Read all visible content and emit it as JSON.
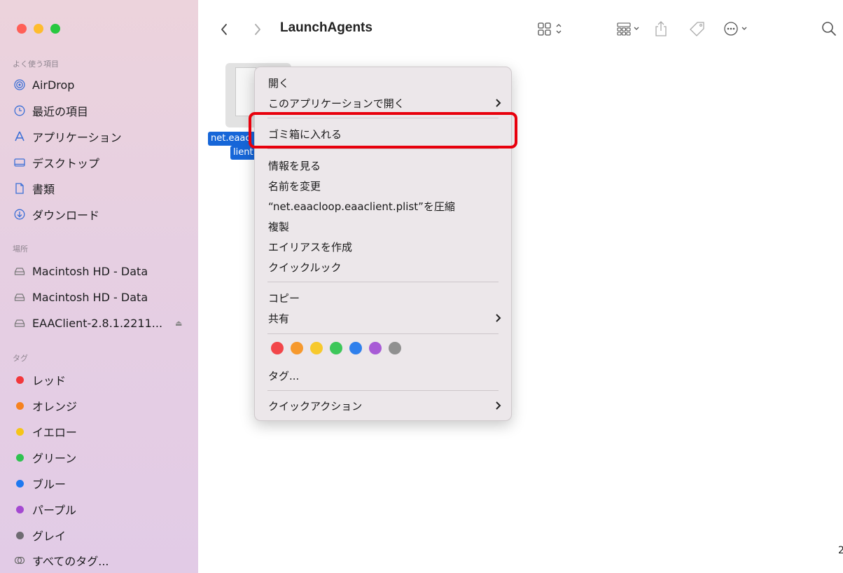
{
  "window": {
    "folder_title": "LaunchAgents"
  },
  "sidebar": {
    "favorites_title": "よく使う項目",
    "favorites": [
      {
        "label": "AirDrop",
        "icon": "airdrop-icon"
      },
      {
        "label": "最近の項目",
        "icon": "clock-icon"
      },
      {
        "label": "アプリケーション",
        "icon": "applications-icon"
      },
      {
        "label": "デスクトップ",
        "icon": "desktop-icon"
      },
      {
        "label": "書類",
        "icon": "document-icon"
      },
      {
        "label": "ダウンロード",
        "icon": "download-icon"
      }
    ],
    "locations_title": "場所",
    "locations": [
      {
        "label": "Macintosh HD - Data",
        "icon": "drive-icon"
      },
      {
        "label": "Macintosh HD - Data",
        "icon": "drive-icon"
      },
      {
        "label": "EAAClient-2.8.1.2211...",
        "icon": "drive-icon"
      }
    ],
    "tags_title": "タグ",
    "tags": [
      {
        "label": "レッド",
        "color": "#f2373b"
      },
      {
        "label": "オレンジ",
        "color": "#f6821f"
      },
      {
        "label": "イエロー",
        "color": "#f5c518"
      },
      {
        "label": "グリーン",
        "color": "#2fc250"
      },
      {
        "label": "ブルー",
        "color": "#1e78f0"
      },
      {
        "label": "パープル",
        "color": "#a449d1"
      },
      {
        "label": "グレイ",
        "color": "#6e6b72"
      }
    ],
    "all_tags_label": "すべてのタグ..."
  },
  "file": {
    "name_line1": "net.eaac",
    "name_line2": "lient"
  },
  "context_menu": {
    "open": "開く",
    "open_with": "このアプリケーションで開く",
    "move_to_trash": "ゴミ箱に入れる",
    "get_info": "情報を見る",
    "rename": "名前を変更",
    "compress": "“net.eaacloop.eaaclient.plist”を圧縮",
    "duplicate": "複製",
    "make_alias": "エイリアスを作成",
    "quick_look": "クイックルック",
    "copy": "コピー",
    "share": "共有",
    "tag_colors": [
      "#f2464a",
      "#f6992d",
      "#f7c92c",
      "#3dc75a",
      "#2f80ec",
      "#a85bd6",
      "#909090"
    ],
    "tags": "タグ...",
    "quick_actions": "クイックアクション"
  },
  "corner_text": "2"
}
